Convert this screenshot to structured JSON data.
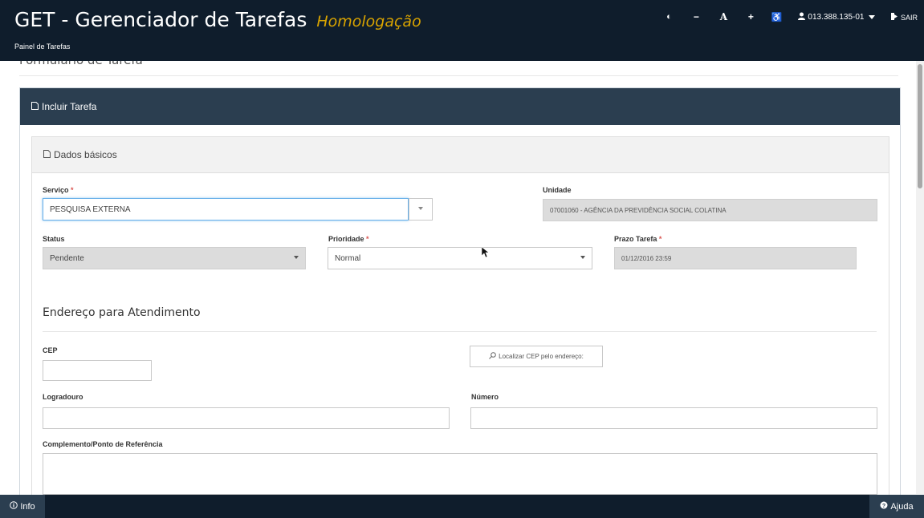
{
  "header": {
    "title": "GET - Gerenciador de Tarefas",
    "environment": "Homologação",
    "nav_link": "Painel de Tarefas",
    "tools": {
      "contrast": "◐",
      "decrease_font": "−",
      "font": "A",
      "increase_font": "+",
      "accessibility": "♿"
    },
    "user": "013.388.135-01",
    "logout": "SAIR"
  },
  "page": {
    "title": "Formulário de Tarefa"
  },
  "panel": {
    "title": "Incluir Tarefa",
    "section_basic": "Dados básicos"
  },
  "form": {
    "servico_label": "Serviço",
    "servico_value": "PESQUISA EXTERNA",
    "unidade_label": "Unidade",
    "unidade_value": "07001060 - AGÊNCIA DA PREVIDÊNCIA SOCIAL COLATINA",
    "status_label": "Status",
    "status_value": "Pendente",
    "prioridade_label": "Prioridade",
    "prioridade_value": "Normal",
    "prazo_label": "Prazo Tarefa",
    "prazo_value": "01/12/2016 23:59",
    "required_mark": "*",
    "address_section": "Endereço para Atendimento",
    "cep_label": "CEP",
    "cep_value": "",
    "cep_search_button": "Localizar CEP pelo endereço:",
    "logradouro_label": "Logradouro",
    "logradouro_value": "",
    "numero_label": "Número",
    "numero_value": "",
    "complemento_label": "Complemento/Ponto de Referência",
    "complemento_value": ""
  },
  "footer": {
    "info": "Info",
    "help": "Ajuda"
  },
  "colors": {
    "header_bg": "#0f1d2c",
    "panel_head_bg": "#2b3e50",
    "environment": "#d8a300",
    "required": "#d9534f",
    "focus_border": "#66afe9"
  }
}
